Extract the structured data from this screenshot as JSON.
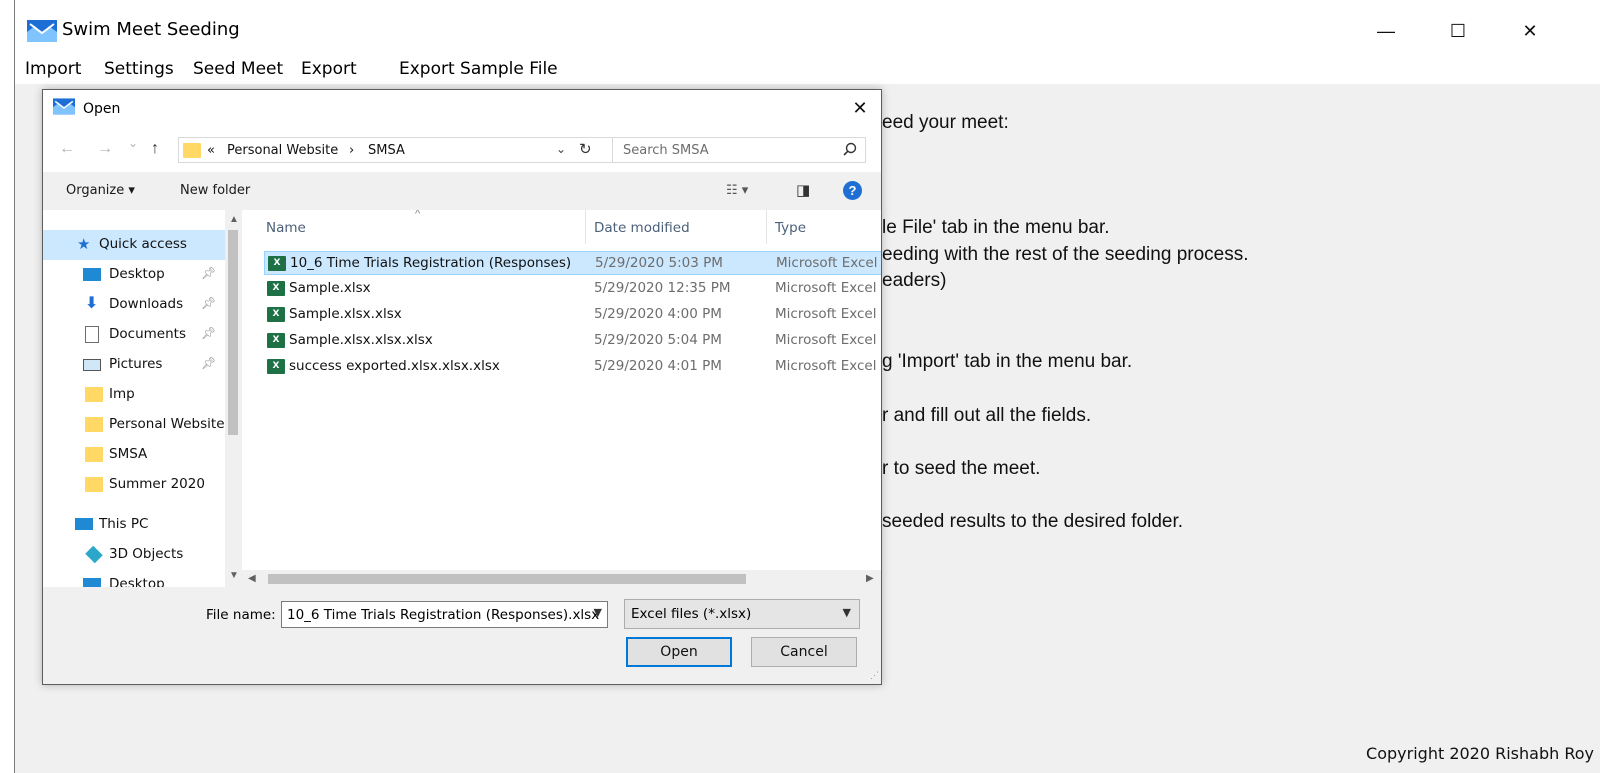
{
  "window": {
    "title": "Swim Meet Seeding",
    "controls": {
      "minimize": "—",
      "maximize": "☐",
      "close": "✕"
    }
  },
  "menu": [
    "Import",
    "Settings",
    "Seed Meet",
    "Export",
    "Export Sample File"
  ],
  "instructions": [
    "eed your meet:",
    "le File' tab in the menu bar.",
    "eeding with the rest of the seeding process.",
    "eaders)",
    "g 'Import' tab in the menu bar.",
    "r and fill out all the fields.",
    "r to seed the meet.",
    "seeded results to the desired folder."
  ],
  "copyright": "Copyright 2020 Rishabh Roy",
  "dialog": {
    "title": "Open",
    "close": "✕",
    "nav": {
      "back": "←",
      "forward": "→",
      "recent": "⌄",
      "up": "↑"
    },
    "address": {
      "prefix": "«",
      "part1": "Personal Website",
      "sep": "›",
      "part2": "SMSA",
      "dropdown": "⌄",
      "refresh": "↻"
    },
    "search_placeholder": "Search SMSA",
    "toolbar": {
      "organize": "Organize ▾",
      "new_folder": "New folder",
      "view": "☷ ▾",
      "pane": "◨",
      "help": "?"
    },
    "nav_pane": [
      {
        "label": "Quick access",
        "icon": "star-icon",
        "indent": 1,
        "pinned": false,
        "selected": true
      },
      {
        "label": "Desktop",
        "icon": "desktop-icon",
        "indent": 2,
        "pinned": true,
        "selected": false
      },
      {
        "label": "Downloads",
        "icon": "download-icon",
        "indent": 2,
        "pinned": true,
        "selected": false
      },
      {
        "label": "Documents",
        "icon": "document-icon",
        "indent": 2,
        "pinned": true,
        "selected": false
      },
      {
        "label": "Pictures",
        "icon": "pictures-icon",
        "indent": 2,
        "pinned": true,
        "selected": false
      },
      {
        "label": "Imp",
        "icon": "folder-icon",
        "indent": 2,
        "pinned": false,
        "selected": false
      },
      {
        "label": "Personal Website",
        "icon": "folder-icon",
        "indent": 2,
        "pinned": false,
        "selected": false
      },
      {
        "label": "SMSA",
        "icon": "folder-icon",
        "indent": 2,
        "pinned": false,
        "selected": false
      },
      {
        "label": "Summer 2020",
        "icon": "folder-icon",
        "indent": 2,
        "pinned": false,
        "selected": false
      },
      {
        "label": "This PC",
        "icon": "computer-icon",
        "indent": 1,
        "pinned": false,
        "selected": false
      },
      {
        "label": "3D Objects",
        "icon": "cube-icon",
        "indent": 2,
        "pinned": false,
        "selected": false
      },
      {
        "label": "Desktop",
        "icon": "desktop-icon",
        "indent": 2,
        "pinned": false,
        "selected": false
      }
    ],
    "columns": {
      "name": "Name",
      "date": "Date modified",
      "type": "Type"
    },
    "files": [
      {
        "name": "10_6 Time Trials Registration (Responses)....",
        "date": "5/29/2020 5:03 PM",
        "type": "Microsoft Excel",
        "selected": true
      },
      {
        "name": "Sample.xlsx",
        "date": "5/29/2020 12:35 PM",
        "type": "Microsoft Excel",
        "selected": false
      },
      {
        "name": "Sample.xlsx.xlsx",
        "date": "5/29/2020 4:00 PM",
        "type": "Microsoft Excel",
        "selected": false
      },
      {
        "name": "Sample.xlsx.xlsx.xlsx",
        "date": "5/29/2020 5:04 PM",
        "type": "Microsoft Excel",
        "selected": false
      },
      {
        "name": "success exported.xlsx.xlsx.xlsx",
        "date": "5/29/2020 4:01 PM",
        "type": "Microsoft Excel",
        "selected": false
      }
    ],
    "file_name_label": "File name:",
    "file_name_value": "10_6 Time Trials Registration (Responses).xlsx",
    "filter": "Excel files (*.xlsx)",
    "open_button": "Open",
    "cancel_button": "Cancel"
  },
  "colors": {
    "selection": "#cce8ff",
    "accent": "#0078d7",
    "excel": "#1e7145",
    "folder": "#ffd866"
  }
}
